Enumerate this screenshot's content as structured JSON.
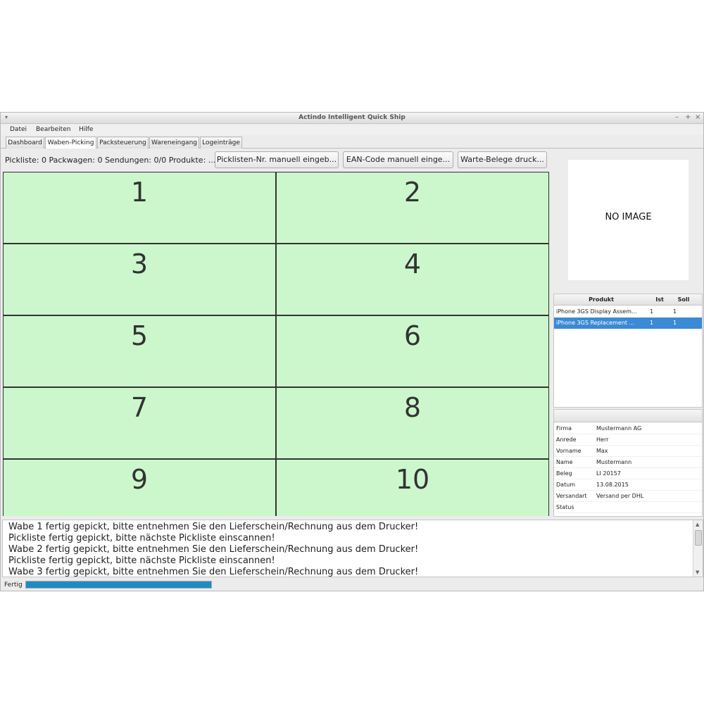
{
  "window": {
    "title": "Actindo Intelligent Quick Ship"
  },
  "menu": [
    "Datei",
    "Bearbeiten",
    "Hilfe"
  ],
  "tabs": [
    {
      "label": "Dashboard",
      "active": false
    },
    {
      "label": "Waben-Picking",
      "active": true
    },
    {
      "label": "Packsteuerung",
      "active": false
    },
    {
      "label": "Wareneingang",
      "active": false
    },
    {
      "label": "Logeinträge",
      "active": false
    }
  ],
  "toolbar": {
    "status": "Pickliste: 0 Packwagen: 0 Sendungen: 0/0 Produkte: ...",
    "picklist_btn": "Picklisten-Nr. manuell eingeb...",
    "ean_btn": "EAN-Code manuell einge...",
    "print_btn": "Warte-Belege druck..."
  },
  "cells": [
    "1",
    "2",
    "3",
    "4",
    "5",
    "6",
    "7",
    "8",
    "9",
    "10"
  ],
  "image": {
    "placeholder": "NO IMAGE"
  },
  "products": {
    "headers": {
      "product": "Produkt",
      "ist": "Ist",
      "soll": "Soll"
    },
    "rows": [
      {
        "product": "iPhone 3GS Display Assem...",
        "ist": "1",
        "soll": "1",
        "selected": false
      },
      {
        "product": "iPhone 3GS Replacement ...",
        "ist": "1",
        "soll": "1",
        "selected": true
      }
    ]
  },
  "customer": [
    {
      "key": "Firma",
      "value": "Mustermann AG"
    },
    {
      "key": "Anrede",
      "value": "Herr"
    },
    {
      "key": "Vorname",
      "value": "Max"
    },
    {
      "key": "Name",
      "value": "Mustermann"
    },
    {
      "key": "Beleg",
      "value": "LI 20157"
    },
    {
      "key": "Datum",
      "value": "13.08.2015"
    },
    {
      "key": "Versandart",
      "value": "Versand per DHL"
    },
    {
      "key": "Status",
      "value": ""
    }
  ],
  "log": [
    "Wabe 1 fertig gepickt, bitte entnehmen Sie den Lieferschein/Rechnung aus dem Drucker!",
    "Pickliste fertig gepickt, bitte nächste Pickliste einscannen!",
    "Wabe 2 fertig gepickt, bitte entnehmen Sie den Lieferschein/Rechnung aus dem Drucker!",
    "Pickliste fertig gepickt, bitte nächste Pickliste einscannen!",
    "Wabe 3 fertig gepickt, bitte entnehmen Sie den Lieferschein/Rechnung aus dem Drucker!"
  ],
  "statusbar": {
    "label": "Fertig",
    "progress": 1.0
  },
  "colors": {
    "cell": "#ccf7cc",
    "selection": "#3a8ad6",
    "progress": "#1d8cc4"
  },
  "icons": {
    "window_menu": "chevron-down-icon",
    "minimize": "minimize-icon",
    "maximize": "maximize-icon",
    "close": "close-icon"
  }
}
